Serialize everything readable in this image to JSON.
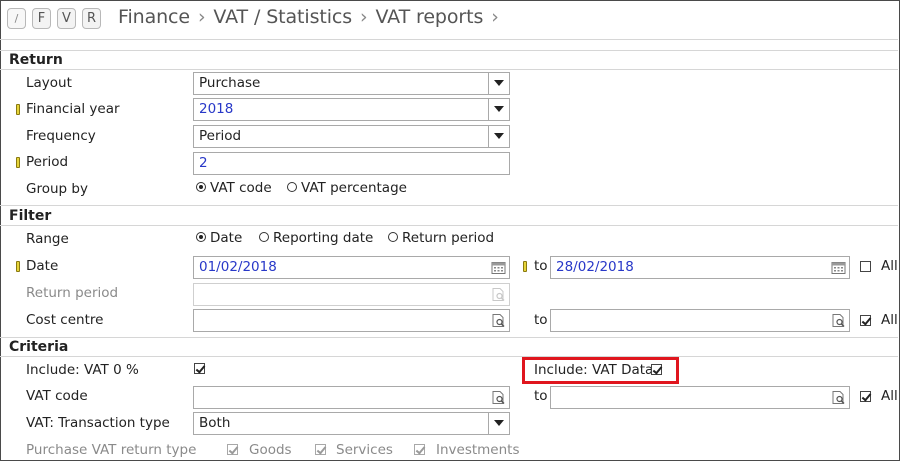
{
  "header": {
    "buttons": [
      "/",
      "F",
      "V",
      "R"
    ],
    "breadcrumb": [
      "Finance",
      "VAT / Statistics",
      "VAT reports"
    ],
    "separator": "›"
  },
  "sections": {
    "return": "Return",
    "filter": "Filter",
    "criteria": "Criteria"
  },
  "return": {
    "layout_label": "Layout",
    "layout_value": "Purchase",
    "financial_year_label": "Financial year",
    "financial_year_value": "2018",
    "frequency_label": "Frequency",
    "frequency_value": "Period",
    "period_label": "Period",
    "period_value": "2",
    "group_by_label": "Group by",
    "group_by_options": [
      "VAT code",
      "VAT percentage"
    ],
    "group_by_selected": "VAT code"
  },
  "filter": {
    "range_label": "Range",
    "range_options": [
      "Date",
      "Reporting date",
      "Return period"
    ],
    "range_selected": "Date",
    "date_label": "Date",
    "date_from": "01/02/2018",
    "to_label": "to",
    "date_to": "28/02/2018",
    "date_all_label": "All",
    "date_all_checked": false,
    "return_period_label": "Return period",
    "cost_centre_label": "Cost centre",
    "cost_centre_from": "",
    "cost_centre_to": "",
    "cost_centre_all_label": "All",
    "cost_centre_all_checked": true
  },
  "criteria": {
    "include_vat0_label": "Include: VAT 0 %",
    "include_vat0_checked": true,
    "include_vat_data_label": "Include: VAT Data",
    "include_vat_data_checked": true,
    "vat_code_label": "VAT code",
    "vat_code_from": "",
    "vat_code_to": "",
    "vat_code_all_label": "All",
    "vat_code_all_checked": true,
    "transaction_type_label": "VAT: Transaction type",
    "transaction_type_value": "Both",
    "purchase_return_type_label": "Purchase VAT return type",
    "purchase_return_type_options": [
      "Goods",
      "Services",
      "Investments"
    ]
  },
  "colors": {
    "highlight": "#e0161e",
    "value_blue": "#2838c8",
    "required_marker": "#e6d43a"
  },
  "icons": {
    "dropdown": "chevron-down-icon",
    "calendar": "calendar-icon",
    "lookup": "lookup-search-icon"
  }
}
